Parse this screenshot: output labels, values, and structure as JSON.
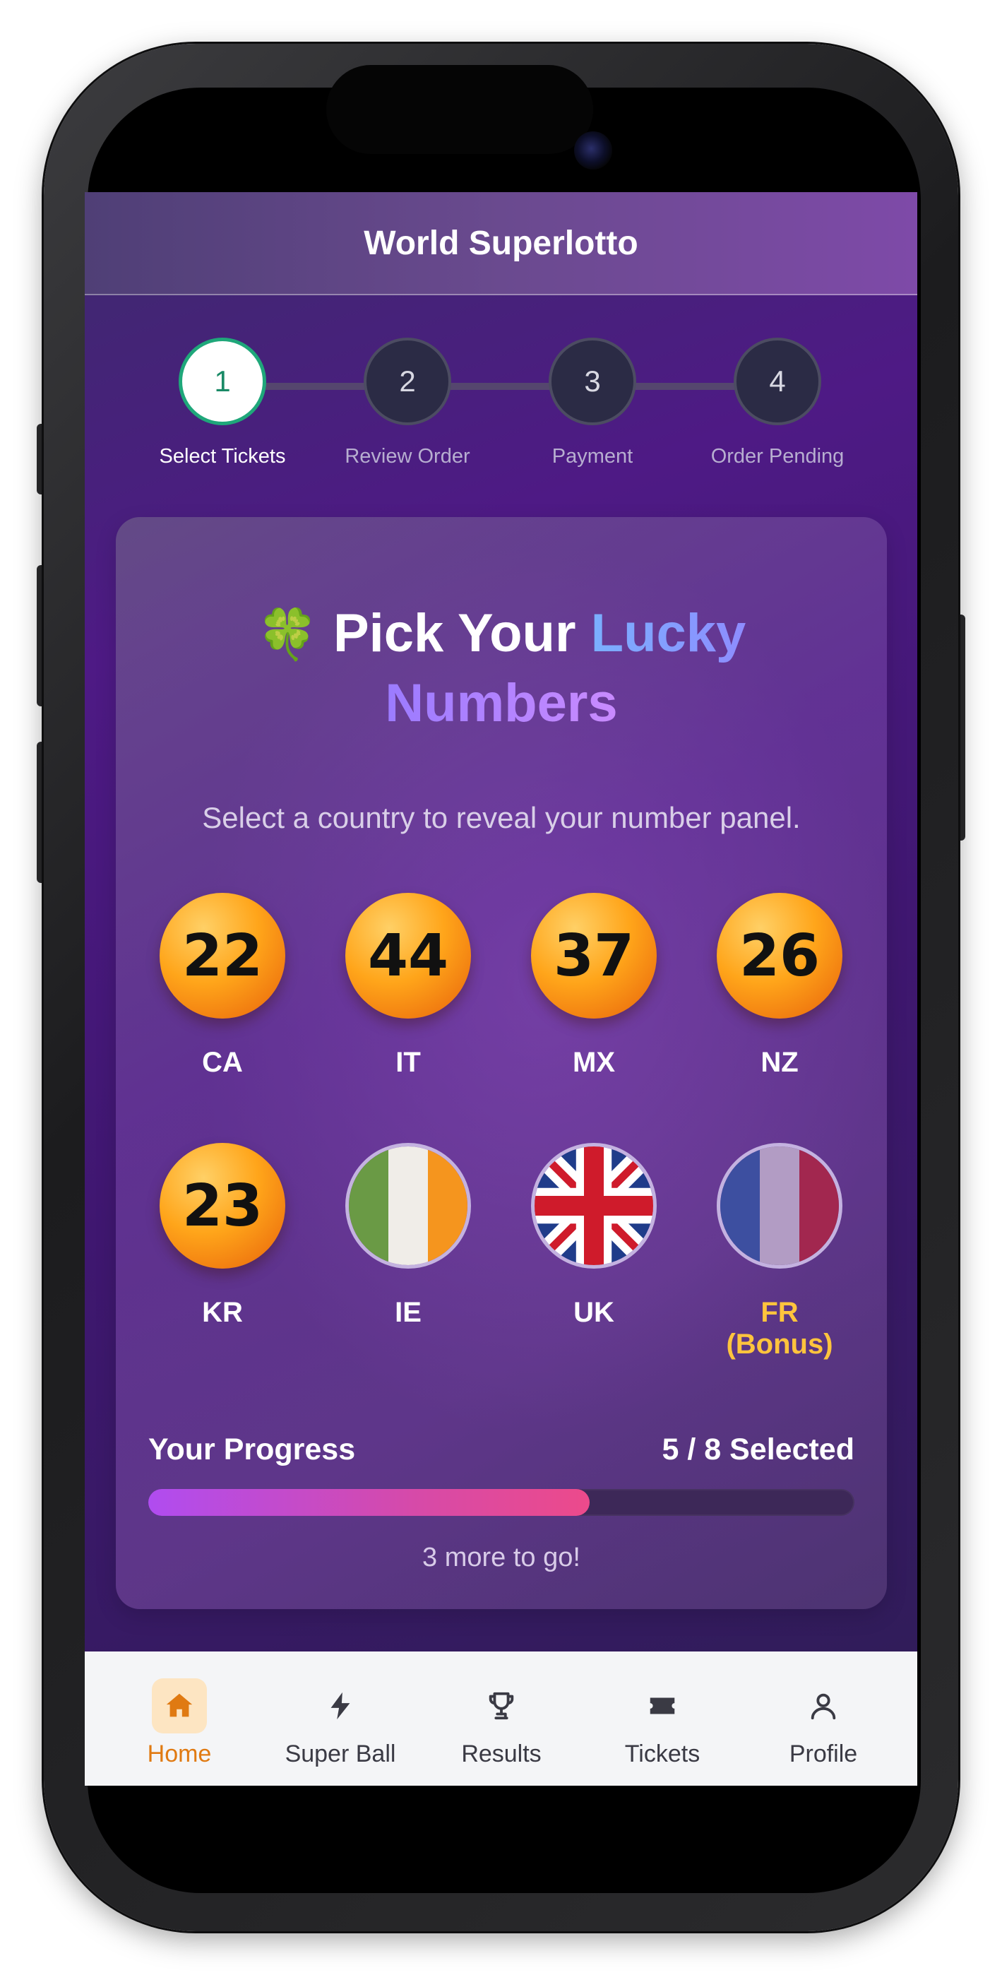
{
  "app": {
    "title": "World Superlotto"
  },
  "stepper": {
    "steps": [
      {
        "number": "1",
        "label": "Select Tickets",
        "active": true
      },
      {
        "number": "2",
        "label": "Review Order",
        "active": false
      },
      {
        "number": "3",
        "label": "Payment",
        "active": false
      },
      {
        "number": "4",
        "label": "Order Pending",
        "active": false
      }
    ]
  },
  "card": {
    "title_icon": "🍀",
    "title_part1": "Pick Your",
    "title_part2": "Lucky",
    "title_part3": "Numbers",
    "subtitle": "Select a country to reveal your number panel."
  },
  "countries": [
    {
      "code": "CA",
      "number": "22",
      "selected": true
    },
    {
      "code": "IT",
      "number": "44",
      "selected": true
    },
    {
      "code": "MX",
      "number": "37",
      "selected": true
    },
    {
      "code": "NZ",
      "number": "26",
      "selected": true
    },
    {
      "code": "KR",
      "number": "23",
      "selected": true
    },
    {
      "code": "IE",
      "flag": "ireland-flag-icon",
      "selected": false
    },
    {
      "code": "UK",
      "flag": "uk-flag-icon",
      "selected": false
    },
    {
      "code": "FR (Bonus)",
      "flag": "france-flag-icon",
      "selected": false,
      "bonus": true
    }
  ],
  "progress": {
    "label": "Your Progress",
    "count_text": "5 / 8 Selected",
    "value": 0.625,
    "note": "3 more to go!"
  },
  "tabbar": {
    "tabs": [
      {
        "label": "Home",
        "icon": "home-icon",
        "active": true
      },
      {
        "label": "Super Ball",
        "icon": "lightning-icon",
        "active": false
      },
      {
        "label": "Results",
        "icon": "trophy-icon",
        "active": false
      },
      {
        "label": "Tickets",
        "icon": "ticket-icon",
        "active": false
      },
      {
        "label": "Profile",
        "icon": "user-icon",
        "active": false
      }
    ]
  },
  "colors": {
    "accent_orange": "#e07a12",
    "step_active_green": "#1fa77a",
    "bonus_gold": "#ffc43d",
    "progress_start": "#b04cf0",
    "progress_end": "#ec4a8b"
  }
}
